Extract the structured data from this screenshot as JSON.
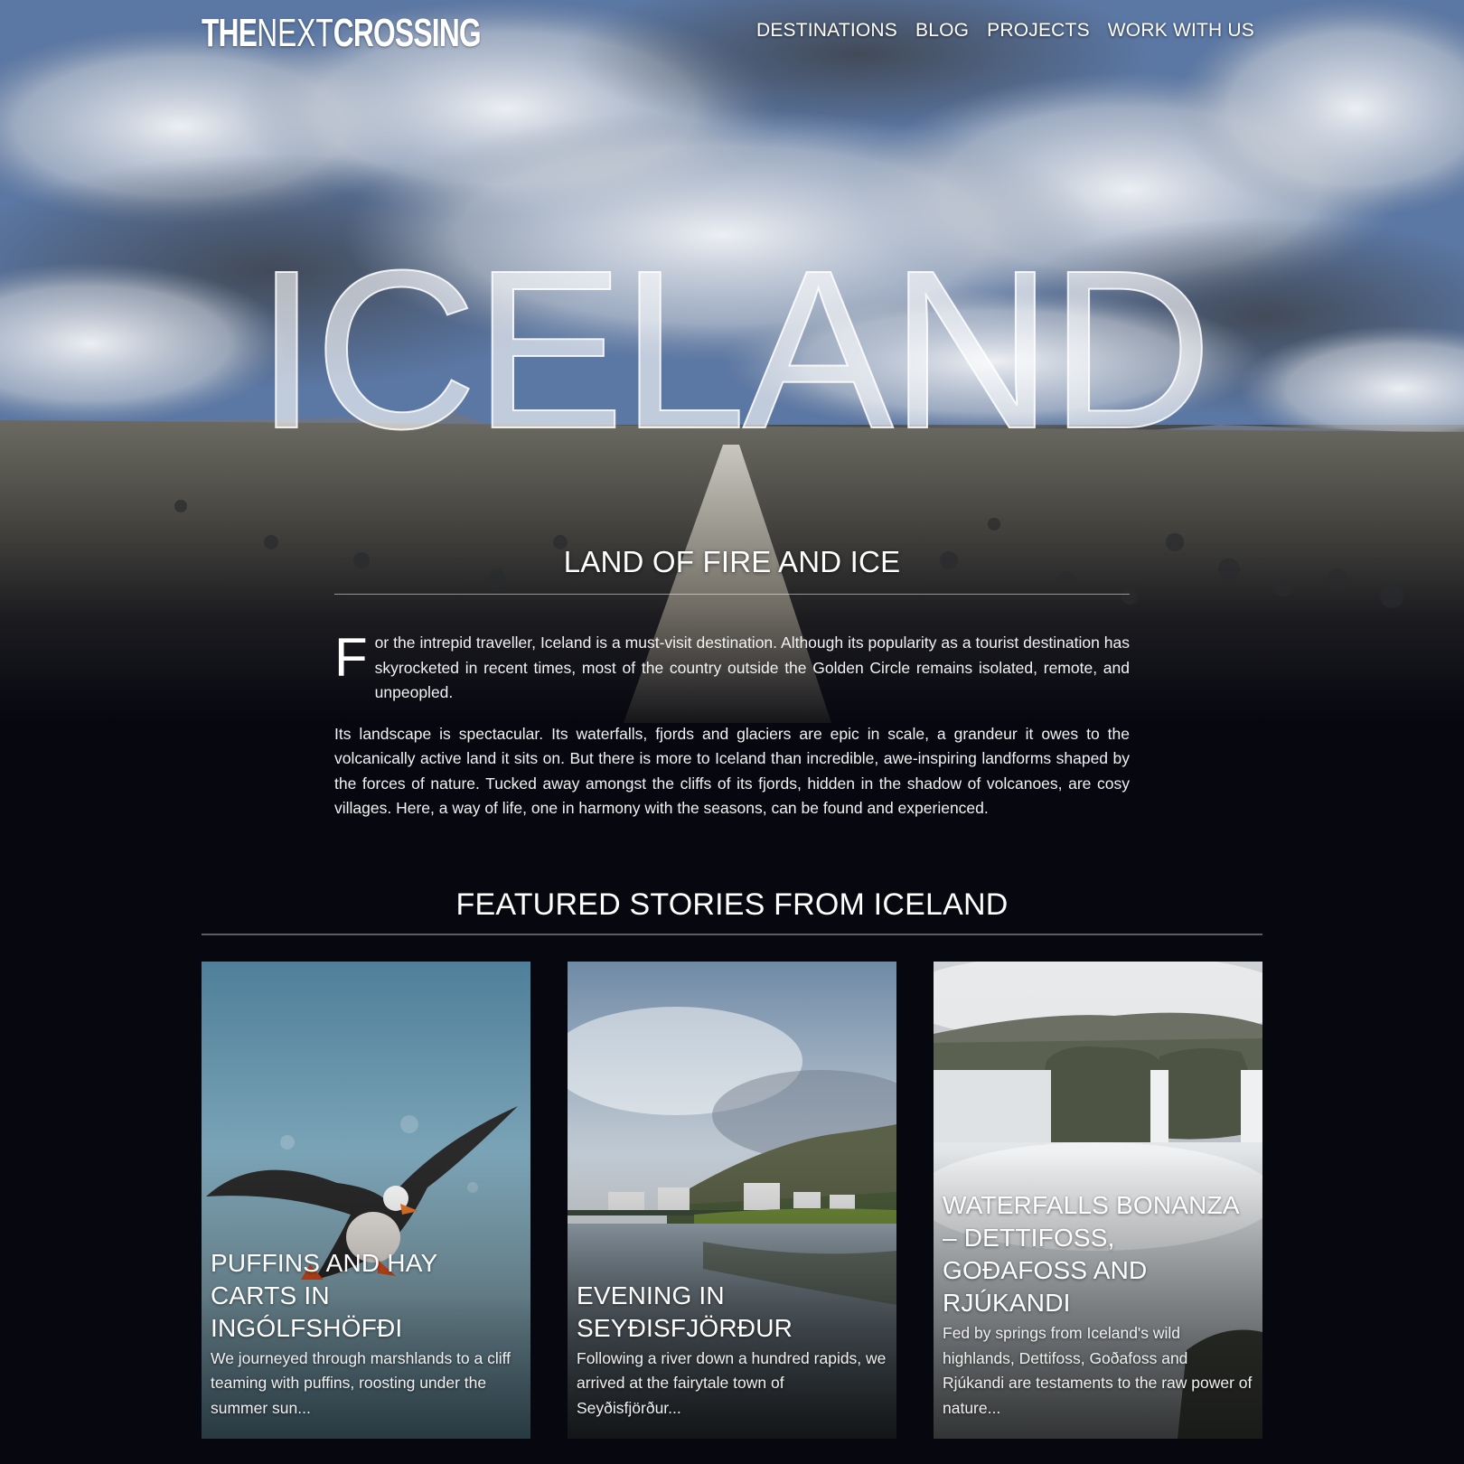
{
  "header": {
    "logo_the": "THE",
    "logo_next": "NEXT",
    "logo_crossing": "CROSSING",
    "nav": [
      "DESTINATIONS",
      "BLOG",
      "PROJECTS",
      "WORK WITH US"
    ]
  },
  "hero": {
    "title": "ICELAND",
    "subtitle": "LAND OF FIRE AND ICE"
  },
  "intro": {
    "dropcap": "F",
    "p1_rest": "or the intrepid traveller, Iceland is a must-visit destination. Although its popularity as a tourist destination has skyrocketed in recent times, most of the country outside the Golden Circle remains isolated, remote, and unpeopled.",
    "p2": "Its landscape is spectacular. Its waterfalls, fjords and glaciers are epic in scale, a grandeur it owes to the volcanically active land it sits on. But there is more to Iceland than incredible, awe-inspiring landforms shaped by the forces of nature. Tucked away amongst the cliffs of its fjords, hidden in the shadow of volcanoes, are cosy villages. Here, a way of life, one in harmony with the seasons, can be found and experienced."
  },
  "featured": {
    "title": "FEATURED STORIES FROM ICELAND",
    "cards": [
      {
        "title": "PUFFINS AND HAY CARTS IN INGÓLFSHÖFÐI",
        "excerpt": "We journeyed through marshlands to a cliff teaming with puffins, roosting under the summer sun..."
      },
      {
        "title": "EVENING IN SEYÐISFJÖRÐUR",
        "excerpt": "Following a river down a hundred rapids, we arrived at the fairytale town of Seyðisfjörður..."
      },
      {
        "title": "WATERFALLS BONANZA – DETTIFOSS, GOÐAFOSS AND RJÚKANDI",
        "excerpt": "Fed by springs from Iceland's wild highlands, Dettifoss, Goðafoss and Rjúkandi are testaments to the raw power of nature..."
      }
    ]
  },
  "colors": {
    "page_bg": "#06070f",
    "text": "#ffffff"
  }
}
